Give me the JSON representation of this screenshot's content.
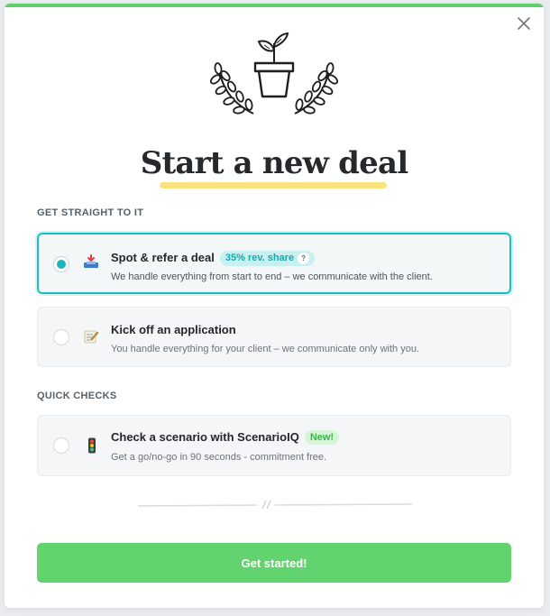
{
  "modal": {
    "title": "Start a new deal",
    "close_icon": "close-icon",
    "illustration_icon": "potted-plant-laurel-icon"
  },
  "sections": {
    "straight": "GET STRAIGHT TO IT",
    "quick": "QUICK CHECKS"
  },
  "options": [
    {
      "title": "Spot & refer a deal",
      "badge": "35% rev. share",
      "badge_help": "?",
      "description": "We handle everything from start to end – we communicate with the client.",
      "icon": "inbox-tray-icon",
      "selected": true
    },
    {
      "title": "Kick off an application",
      "description": "You handle everything for your client – we communicate only with you.",
      "icon": "memo-icon",
      "selected": false
    },
    {
      "title": "Check a scenario with ScenarioIQ",
      "badge": "New!",
      "description": "Get a go/no-go in 90 seconds - commitment free.",
      "icon": "traffic-light-icon",
      "selected": false
    }
  ],
  "cta": {
    "label": "Get started!"
  },
  "colors": {
    "accent": "#5fd068",
    "selected_border": "#1fbfbf",
    "title_highlight": "#fbe27c",
    "cta": "#62d36e"
  }
}
